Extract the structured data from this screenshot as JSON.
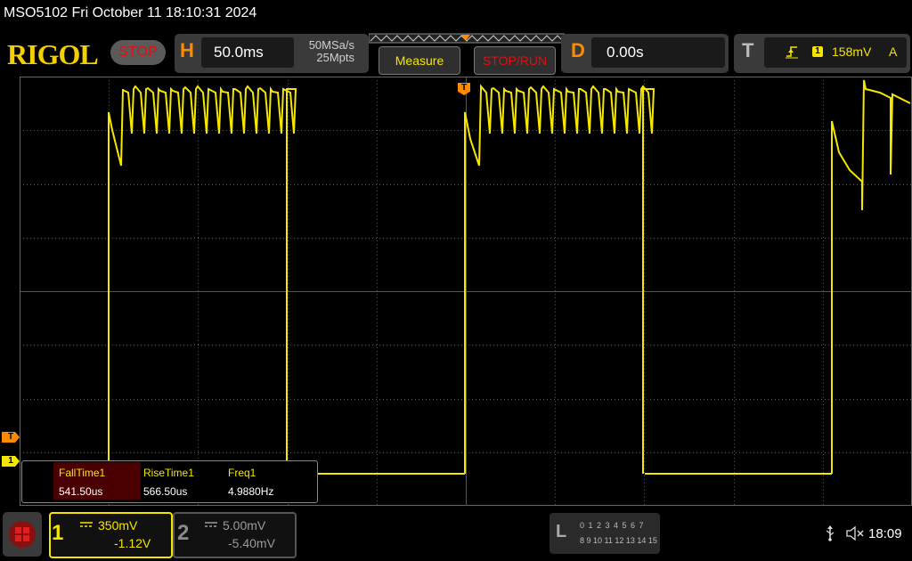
{
  "header": {
    "title": "MSO5102  Fri October 11 18:10:31 2024"
  },
  "toolbar": {
    "logo": "RIGOL",
    "status": "STOP",
    "horizontal": {
      "letter": "H",
      "timebase": "50.0ms",
      "sample_rate": "50MSa/s",
      "memory_depth": "25Mpts"
    },
    "measure_label": "Measure",
    "stoprun_label": "STOP/RUN",
    "delay": {
      "letter": "D",
      "value": "0.00s"
    },
    "trigger": {
      "letter": "T",
      "edge_icon": "rising-edge-icon",
      "channel": "1",
      "level": "158mV",
      "mode": "A"
    }
  },
  "markers": {
    "trigger_top": "T",
    "trigger_left": "T",
    "channel1_left": "1"
  },
  "measurements": {
    "items": [
      {
        "label": "FallTime1",
        "value": "541.50us"
      },
      {
        "label": "RiseTime1",
        "value": "566.50us"
      },
      {
        "label": "Freq1",
        "value": "4.9880Hz"
      }
    ]
  },
  "channels": {
    "ch1": {
      "number": "1",
      "scale": "350mV",
      "offset": "-1.12V",
      "color": "#f5e600",
      "coupling_icon": "dc-coupling-icon"
    },
    "ch2": {
      "number": "2",
      "scale": "5.00mV",
      "offset": "-5.40mV",
      "color": "#8a8a8a",
      "coupling_icon": "dc-coupling-icon"
    }
  },
  "logic": {
    "letter": "L",
    "row1": "0 1 2 3   4 5 6 7",
    "row2": "8 9 10 11 12 13 14 15"
  },
  "status_bar": {
    "usb_icon": "usb-icon",
    "speaker_icon": "speaker-muted-icon",
    "time": "18:09"
  },
  "colors": {
    "trace": "#f5e600",
    "accent": "#ff8a00",
    "stop": "#e01010"
  }
}
